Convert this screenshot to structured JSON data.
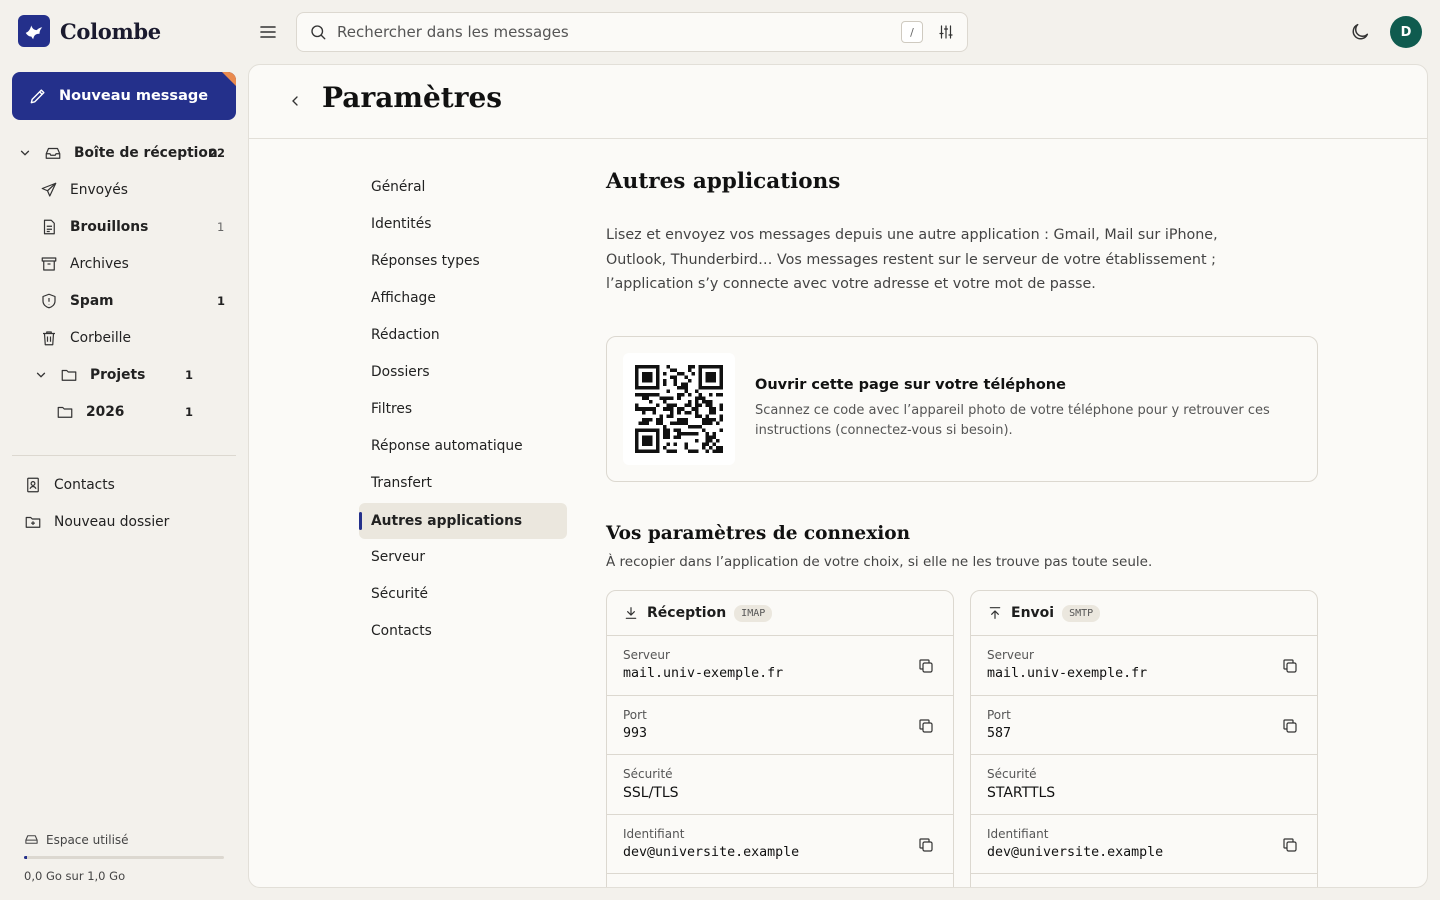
{
  "app": {
    "name": "Colombe",
    "avatar_initial": "D",
    "accent": "#24308b"
  },
  "search": {
    "placeholder": "Rechercher dans les messages",
    "shortcut": "/"
  },
  "sidebar": {
    "compose_label": "Nouveau message",
    "items": [
      {
        "label": "Boîte de réception",
        "count": "22"
      },
      {
        "label": "Envoyés",
        "count": ""
      },
      {
        "label": "Brouillons",
        "count": "1"
      },
      {
        "label": "Archives",
        "count": ""
      },
      {
        "label": "Spam",
        "count": "1"
      },
      {
        "label": "Corbeille",
        "count": ""
      },
      {
        "label": "Projets",
        "count": "1"
      },
      {
        "label": "2026",
        "count": "1"
      }
    ],
    "contacts_label": "Contacts",
    "new_folder_label": "Nouveau dossier",
    "storage": {
      "label": "Espace utilisé",
      "text": "0,0 Go sur 1,0 Go",
      "used_fraction": 0.01
    }
  },
  "page": {
    "title": "Paramètres"
  },
  "settings_nav": [
    "Général",
    "Identités",
    "Réponses types",
    "Affichage",
    "Rédaction",
    "Dossiers",
    "Filtres",
    "Réponse automatique",
    "Transfert",
    "Autres applications",
    "Serveur",
    "Sécurité",
    "Contacts"
  ],
  "content": {
    "title": "Autres applications",
    "intro": "Lisez et envoyez vos messages depuis une autre application : Gmail, Mail sur iPhone, Outlook, Thunderbird… Vos messages restent sur le serveur de votre établissement ; l’application s’y connecte avec votre adresse et votre mot de passe.",
    "qr": {
      "title": "Ouvrir cette page sur votre téléphone",
      "desc": "Scannez ce code avec l’appareil photo de votre téléphone pour y retrouver ces instructions (connectez-vous si besoin)."
    },
    "connection_title": "Vos paramètres de connexion",
    "connection_sub": "À recopier dans l’application de votre choix, si elle ne les trouve pas toute seule.",
    "incoming": {
      "title": "Réception",
      "tag": "IMAP",
      "rows": [
        {
          "label": "Serveur",
          "value": "mail.univ-exemple.fr"
        },
        {
          "label": "Port",
          "value": "993"
        },
        {
          "label": "Sécurité",
          "value": "SSL/TLS"
        },
        {
          "label": "Identifiant",
          "value": "dev@universite.example"
        }
      ]
    },
    "outgoing": {
      "title": "Envoi",
      "tag": "SMTP",
      "rows": [
        {
          "label": "Serveur",
          "value": "mail.univ-exemple.fr"
        },
        {
          "label": "Port",
          "value": "587"
        },
        {
          "label": "Sécurité",
          "value": "STARTTLS"
        },
        {
          "label": "Identifiant",
          "value": "dev@universite.example"
        }
      ]
    }
  }
}
